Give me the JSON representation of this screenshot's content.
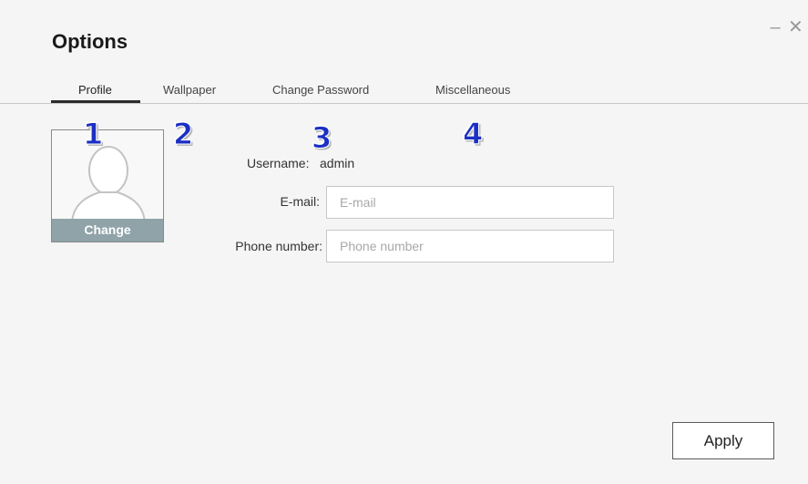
{
  "window": {
    "title": "Options",
    "minimize_icon": "minimize-icon",
    "close_icon": "close-icon",
    "minimize_glyph": "–",
    "close_glyph": "✕"
  },
  "tabs": [
    {
      "label": "Profile",
      "active": true
    },
    {
      "label": "Wallpaper",
      "active": false
    },
    {
      "label": "Change Password",
      "active": false
    },
    {
      "label": "Miscellaneous",
      "active": false
    }
  ],
  "callouts": [
    "1",
    "2",
    "3",
    "4"
  ],
  "profile": {
    "avatar_icon": "user-silhouette-icon",
    "change_label": "Change",
    "username_label": "Username:",
    "username_value": "admin",
    "email_label": "E-mail:",
    "email_value": "",
    "email_placeholder": "E-mail",
    "phone_label": "Phone number:",
    "phone_value": "",
    "phone_placeholder": "Phone number"
  },
  "footer": {
    "apply_label": "Apply"
  },
  "colors": {
    "callout": "#1b2fc4",
    "change_button": "#8fa3a8",
    "dialog_background": "#f5f5f5"
  }
}
